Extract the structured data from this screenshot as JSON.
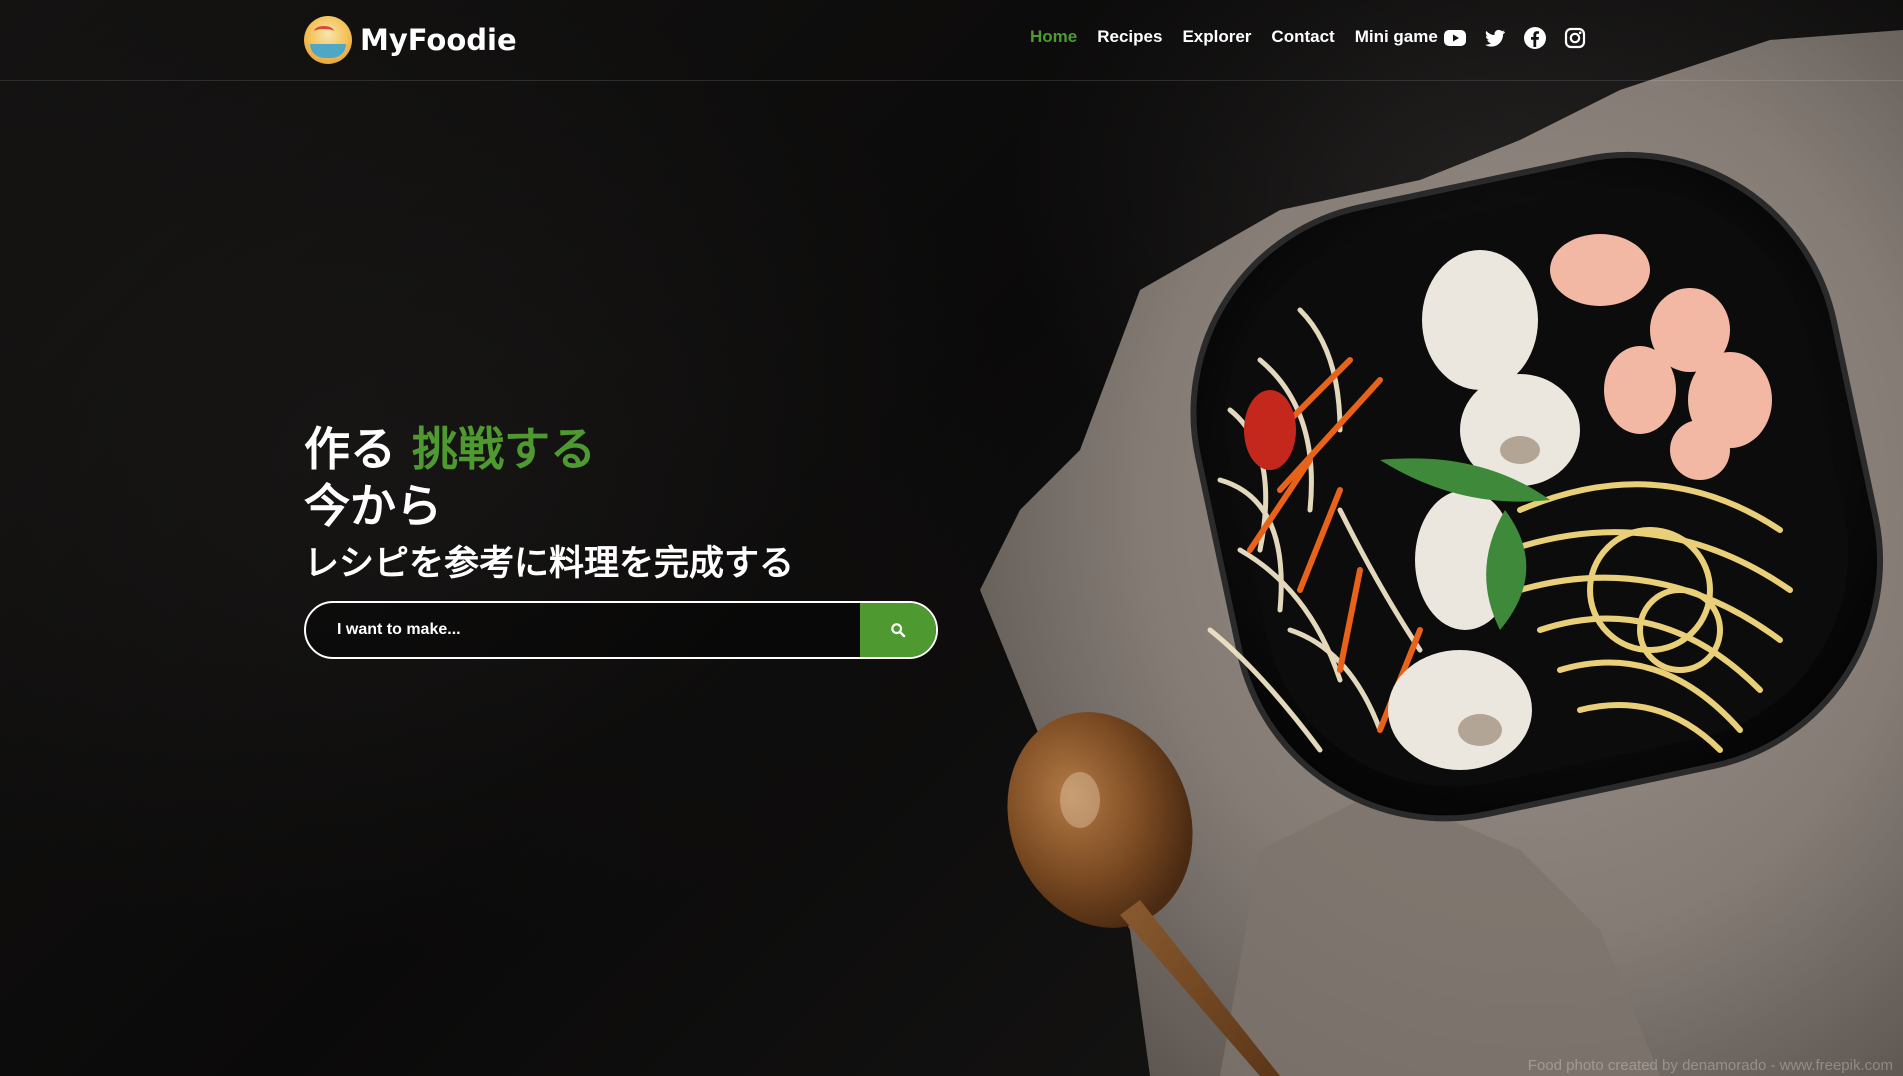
{
  "brand": {
    "name": "MyFoodie",
    "logo_icon": "bowl-logo-icon"
  },
  "nav": {
    "items": [
      {
        "label": "Home",
        "active": true
      },
      {
        "label": "Recipes",
        "active": false
      },
      {
        "label": "Explorer",
        "active": false
      },
      {
        "label": "Contact",
        "active": false
      },
      {
        "label": "Mini game",
        "active": false
      }
    ],
    "social_icons": [
      "youtube-icon",
      "twitter-icon",
      "facebook-icon",
      "instagram-icon"
    ]
  },
  "hero": {
    "line1_plain": "作る",
    "line1_accent": "挑戦する",
    "line2": "今から",
    "line3": "レシピを参考に料理を完成する"
  },
  "search": {
    "placeholder": "I want to make...",
    "value": "",
    "button_icon": "search-icon"
  },
  "footer": {
    "credit": "Food photo created by denamorado - www.freepik.com"
  },
  "colors": {
    "accent": "#4e9a31",
    "background": "#0d0c0b",
    "text": "#ffffff"
  }
}
